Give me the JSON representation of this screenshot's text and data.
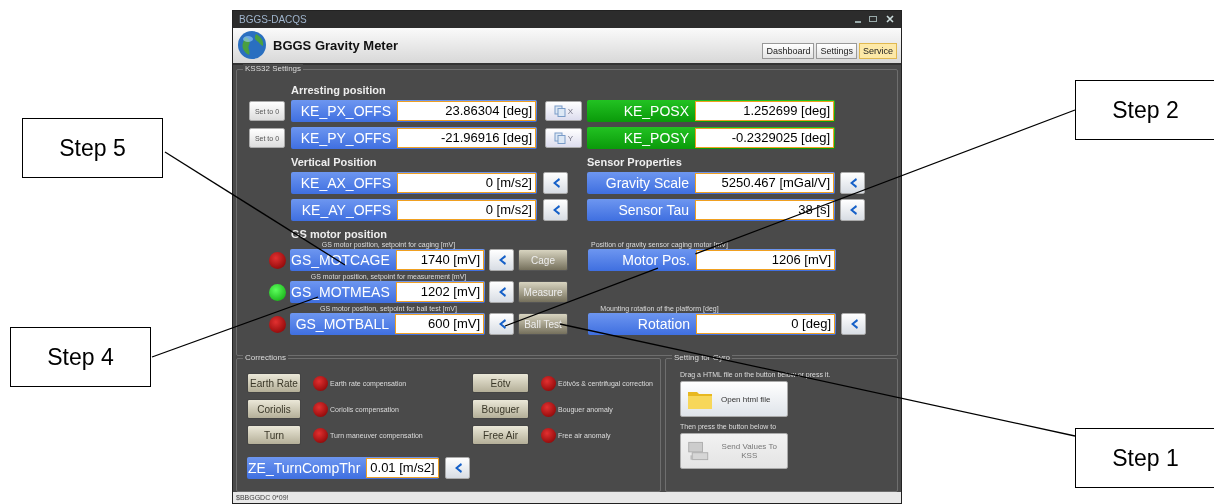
{
  "window": {
    "title": "BGGS-DACQS"
  },
  "header": {
    "title": "BGGS Gravity Meter",
    "tabs": [
      {
        "label": "Dashboard",
        "selected": false
      },
      {
        "label": "Settings",
        "selected": false
      },
      {
        "label": "Service",
        "selected": true
      }
    ]
  },
  "kss32": {
    "title": "KSS32 Settings",
    "arresting": {
      "heading": "Arresting position",
      "rows": [
        {
          "reset": "Set to 0",
          "label": "KE_PX_OFFS",
          "value": "23.86304 [deg]",
          "copy": "X",
          "pos_label": "KE_POSX",
          "pos_value": "1.252699 [deg]"
        },
        {
          "reset": "Set to 0",
          "label": "KE_PY_OFFS",
          "value": "-21.96916 [deg]",
          "copy": "Y",
          "pos_label": "KE_POSY",
          "pos_value": "-0.2329025 [deg]"
        }
      ]
    },
    "vertical": {
      "heading": "Vertical Position",
      "rows": [
        {
          "label": "KE_AX_OFFS",
          "value": "0 [m/s2]"
        },
        {
          "label": "KE_AY_OFFS",
          "value": "0 [m/s2]"
        }
      ]
    },
    "sensor": {
      "heading": "Sensor Properties",
      "rows": [
        {
          "label": "Gravity Scale",
          "value": "5250.467 [mGal/V]"
        },
        {
          "label": "Sensor Tau",
          "value": "38 [s]"
        }
      ]
    },
    "motor": {
      "heading": "GS motor position",
      "rows": [
        {
          "hint": "GS motor position, setpoint for caging [mV]",
          "on": false,
          "label": "GS_MOTCAGE",
          "value": "1740 [mV]",
          "action": "Cage",
          "right": {
            "kind": "readout",
            "hint": "Position of gravity sensor caging motor [mV]",
            "label": "Motor Pos.",
            "value": "1206 [mV]"
          }
        },
        {
          "hint": "GS motor position, setpoint for measurement [mV]",
          "on": true,
          "label": "GS_MOTMEAS",
          "value": "1202 [mV]",
          "action": "Measure"
        },
        {
          "hint": "GS motor position, setpoint for ball test [mV]",
          "on": false,
          "label": "GS_MOTBALL",
          "value": "600 [mV]",
          "action": "Ball Test",
          "right": {
            "kind": "setting",
            "hint": "Mounting rotation of the platform [deg]",
            "label": "Rotation",
            "value": "0 [deg]"
          }
        }
      ]
    }
  },
  "corrections": {
    "title": "Corrections",
    "items": [
      {
        "button": "Earth Rate",
        "on": false,
        "description": "Earth rate compensation"
      },
      {
        "button": "Eötv",
        "on": false,
        "description": "Eötvös & centrifugal correction"
      },
      {
        "button": "Coriolis",
        "on": false,
        "description": "Coriolis compensation"
      },
      {
        "button": "Bouguer",
        "on": false,
        "description": "Bouguer anomaly"
      },
      {
        "button": "Turn",
        "on": false,
        "description": "Turn maneuver compensation"
      },
      {
        "button": "Free Air",
        "on": false,
        "description": "Free air anomaly"
      }
    ],
    "threshold": {
      "label": "ZE_TurnCompThr",
      "value": "0.01 [m/s2]"
    }
  },
  "gyro": {
    "title": "Setting for Gyro",
    "instruction": "Drag a HTML file on the button below or press it.",
    "open_button": {
      "label": "Open html file",
      "disabled": false
    },
    "note": "Then press the button below to",
    "send_button": {
      "label": "Send Values To KSS",
      "disabled": true
    }
  },
  "status_bar": "$BBGGDC 0*09!",
  "callouts": [
    {
      "label": "Step 5"
    },
    {
      "label": "Step 4"
    },
    {
      "label": "Step 2"
    },
    {
      "label": "Step 1"
    }
  ]
}
